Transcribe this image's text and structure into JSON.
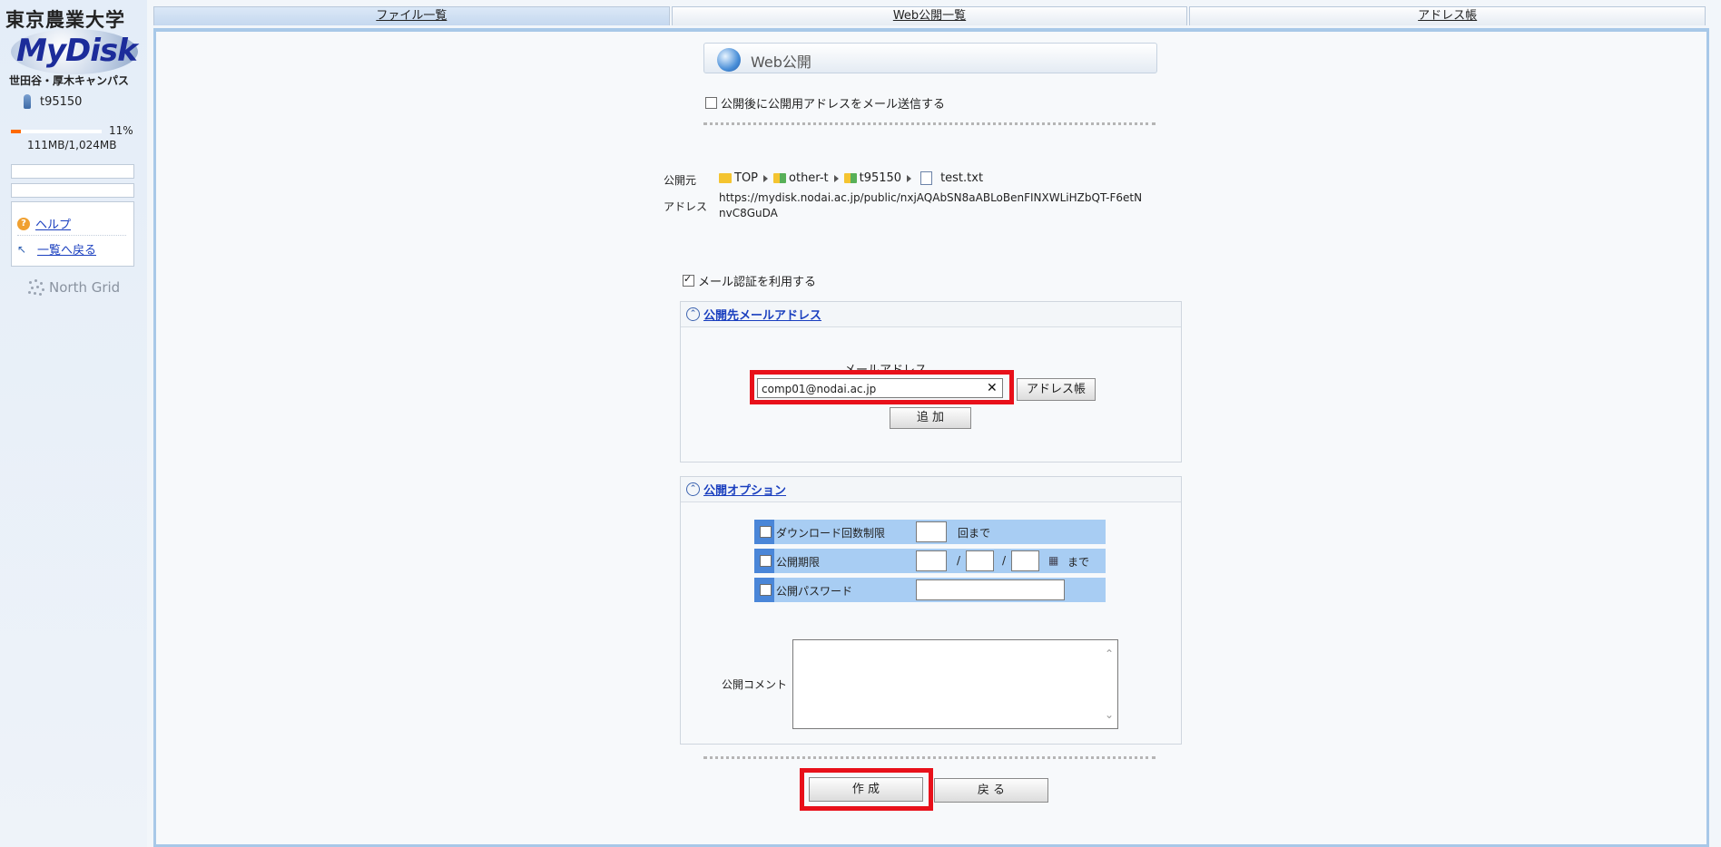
{
  "sidebar": {
    "logo_top": "東京農業大学",
    "logo_name": "MyDisk",
    "logo_campus": "世田谷・厚木キャンパス",
    "username": "t95150",
    "quota_fraction": 0.11,
    "quota_percent": "11%",
    "quota_text": "111MB/1,024MB",
    "help_label": "ヘルプ",
    "back_label": "一覧へ戻る",
    "brand": "North Grid"
  },
  "tabs": [
    {
      "label": "ファイル一覧"
    },
    {
      "label": "Web公開一覧"
    },
    {
      "label": "アドレス帳"
    }
  ],
  "page": {
    "title": "Web公開",
    "mail_send_label": "公開後に公開用アドレスをメール送信する",
    "source_label": "公開元",
    "address_label": "アドレス",
    "breadcrumb": [
      "TOP",
      "other-t",
      "t95150",
      "test.txt"
    ],
    "url": "https://mydisk.nodai.ac.jp/public/nxjAQAbSN8aABLoBenFINXWLiHZbQT-F6etNnvC8GuDA",
    "mail_auth_label": "メール認証を利用する"
  },
  "mail_section": {
    "heading": "公開先メールアドレス",
    "field_label": "メールアドレス",
    "email_value": "comp01@nodai.ac.jp",
    "address_book_button": "アドレス帳",
    "add_button": "追 加"
  },
  "options_section": {
    "heading": "公開オプション",
    "download_limit_label": "ダウンロード回数制限",
    "download_limit_suffix": "回まで",
    "expiry_label": "公開期限",
    "expiry_sep": "/",
    "expiry_suffix": "まで",
    "password_label": "公開パスワード",
    "comment_label": "公開コメント"
  },
  "actions": {
    "create_button": "作 成",
    "back_button": "戻 る"
  },
  "colors": {
    "highlight": "#e8101a",
    "option_row": "#a8cdf3",
    "option_stripe": "#4a86d8",
    "link": "#1a3fbf"
  }
}
